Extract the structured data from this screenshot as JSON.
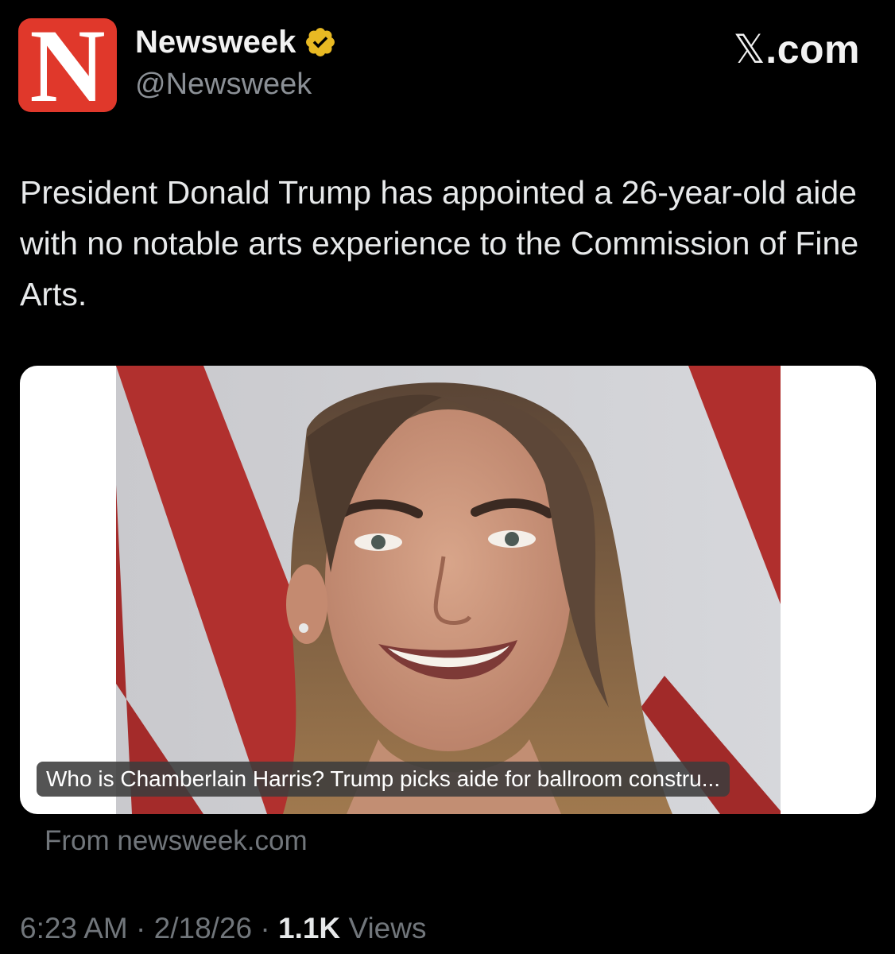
{
  "account": {
    "avatar_letter": "N",
    "display_name": "Newsweek",
    "handle": "@Newsweek",
    "verified_badge": "gold-verified-badge-icon"
  },
  "brand": {
    "x_glyph": "𝕏",
    "domain_suffix": ".com"
  },
  "tweet": {
    "text": "President Donald Trump has appointed a 26-year-old aide with no notable arts experience to the Commission of Fine Arts."
  },
  "link_card": {
    "caption": "Who is Chamberlain Harris? Trump picks aide for ballroom constru...",
    "source": "From newsweek.com"
  },
  "meta": {
    "time": "6:23 AM",
    "separator": "·",
    "date": "2/18/26",
    "views_count": "1.1K",
    "views_label": "Views"
  },
  "colors": {
    "background": "#000000",
    "avatar_red": "#e0382b",
    "verified_gold": "#e8b923",
    "muted_text": "#71767b"
  }
}
